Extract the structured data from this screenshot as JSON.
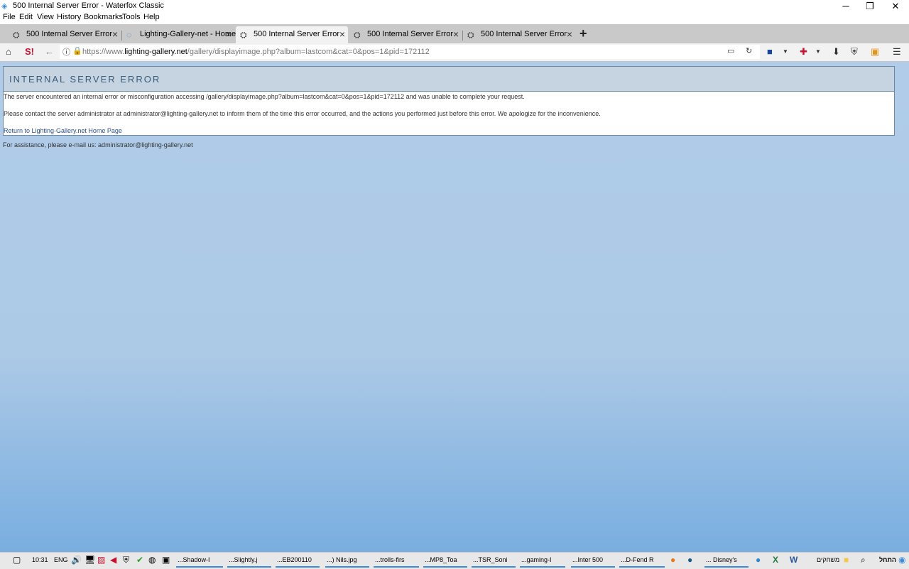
{
  "window": {
    "title": "500 Internal Server Error - Waterfox Classic",
    "app_icon": "waterfox-icon"
  },
  "menu": [
    "File",
    "Edit",
    "View",
    "History",
    "Bookmarks",
    "Tools",
    "Help"
  ],
  "tabs": [
    {
      "label": "500 Internal Server Error",
      "icon": "network-icon"
    },
    {
      "label": "Lighting-Gallery-net - Home",
      "icon": "loading-icon"
    },
    {
      "label": "500 Internal Server Error",
      "icon": "network-icon"
    },
    {
      "label": "500 Internal Server Error",
      "icon": "network-icon"
    },
    {
      "label": "500 Internal Server Error",
      "icon": "network-icon"
    }
  ],
  "urlbar": {
    "prefix": "https://www.",
    "domain": "lighting-gallery.net",
    "path": "/gallery/displayimage.php?album=lastcom&cat=0&pos=1&pid=172112"
  },
  "page": {
    "title": "INTERNAL SERVER ERROR",
    "line1": "The server encountered an internal error or misconfiguration accessing /gallery/displayimage.php?album=lastcom&cat=0&pos=1&pid=172112 and was unable to complete your request.",
    "line2": "Please contact the server administrator at administrator@lighting-gallery.net to inform them of the time this error occurred, and the actions you performed just before this error. We apologize for the inconvenience.",
    "link": "Return to Lighting-Gallery.net Home Page",
    "assist": "For assistance, please e-mail us: administrator@lighting-gallery.net"
  },
  "taskbar": {
    "time": "10:31",
    "lang": "ENG",
    "windows": [
      "...Shadow-I",
      "...Slightly.j",
      "...EB200110",
      "...) Nils.jpg",
      "...trolls-firs",
      "...MP8_Toa",
      "...TSR_Soni",
      "...gaming-I",
      "...Inter 500",
      "...D-Fend R",
      "... Disney's"
    ],
    "start": "התחל",
    "games": "משחקים"
  },
  "colors": {
    "accent": "#3c8ad8",
    "page_bg": "#acc9e6",
    "error_header": "#c6d4e2"
  }
}
